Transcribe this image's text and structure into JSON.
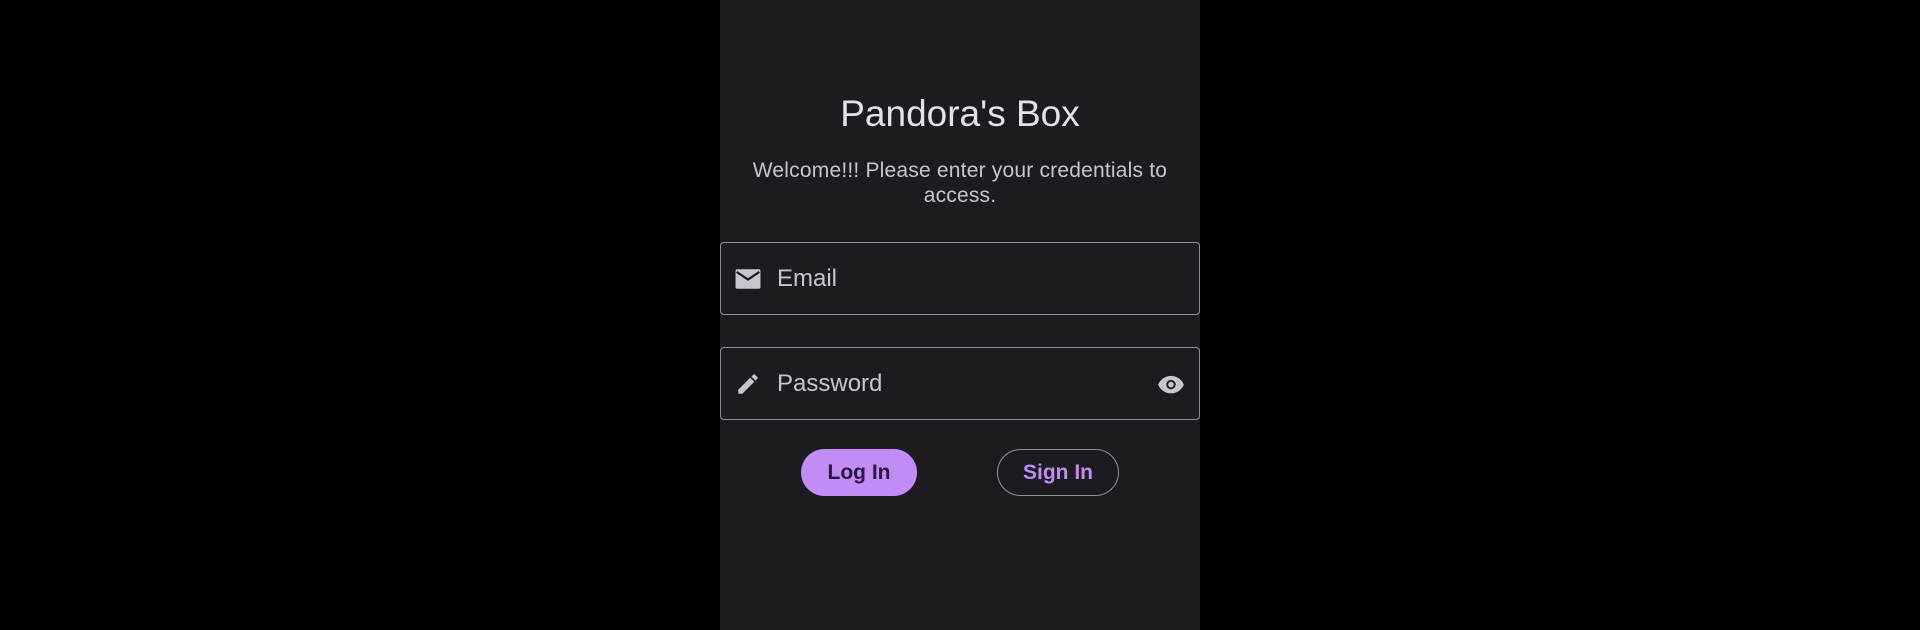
{
  "app": {
    "title": "Pandora's Box",
    "subtitle": "Welcome!!! Please enter your credentials to access."
  },
  "form": {
    "email": {
      "value": "",
      "placeholder": "Email",
      "icon": "mail-icon"
    },
    "password": {
      "value": "",
      "placeholder": "Password",
      "icon": "pencil-icon",
      "toggle_icon": "eye-icon"
    }
  },
  "actions": {
    "login_label": "Log In",
    "signin_label": "Sign In"
  },
  "colors": {
    "background": "#000000",
    "surface": "#1d1b20",
    "primary": "#c18cf6",
    "outline": "#938f99",
    "on_surface": "#e6e0e9"
  }
}
